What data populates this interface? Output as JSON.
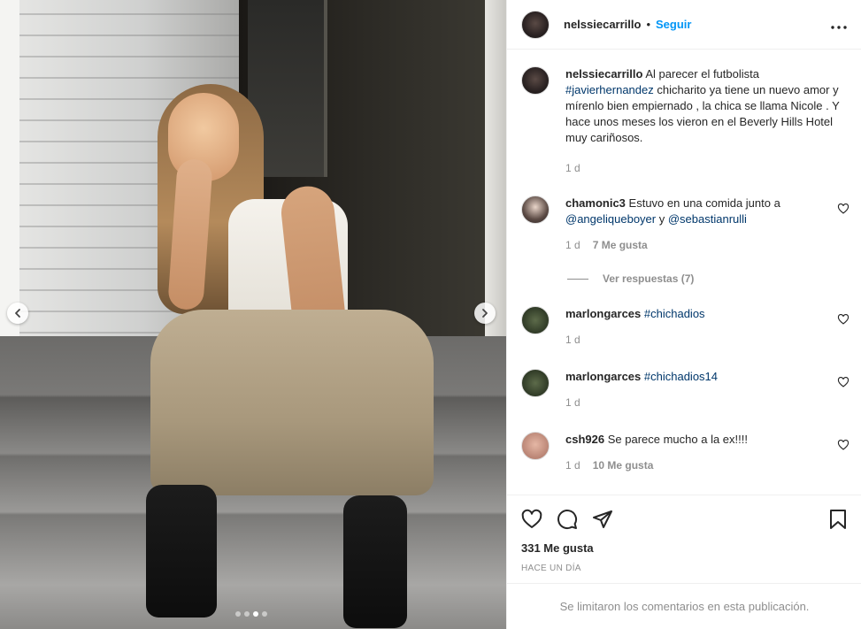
{
  "post": {
    "username": "nelssiecarrillo",
    "separator": "•",
    "follow_label": "Seguir",
    "more_icon": "more-horizontal-icon",
    "carousel": {
      "prev_icon": "chevron-left-icon",
      "next_icon": "chevron-right-icon",
      "slide_count": 4,
      "active_index": 2
    }
  },
  "caption": {
    "username": "nelssiecarrillo",
    "text_before": "Al parecer el futbolista",
    "hashtag": "#javierhernandez",
    "text_after": "chicharito ya tiene un nuevo amor y mírenlo bien empiernado , la chica se llama Nicole . Y hace unos meses los vieron en el Beverly Hills Hotel muy cariñosos.",
    "time": "1 d"
  },
  "comments": [
    {
      "username": "chamonic3",
      "text_before": "Estuvo en una comida junto a",
      "mention1": "@angeliqueboyer",
      "joiner": "y",
      "mention2": "@sebastianrulli",
      "time": "1 d",
      "likes": "7 Me gusta",
      "replies_label": "Ver respuestas (7)"
    },
    {
      "username": "marlongarces",
      "hashtag": "#chichadios",
      "time": "1 d"
    },
    {
      "username": "marlongarces",
      "hashtag": "#chichadios14",
      "time": "1 d"
    },
    {
      "username": "csh926",
      "text": "Se parece mucho a la ex!!!!",
      "time": "1 d",
      "likes": "10 Me gusta"
    }
  ],
  "actions": {
    "like_count": "331 Me gusta",
    "time_ago": "HACE UN DÍA",
    "limited_notice": "Se limitaron los comentarios en esta publicación."
  },
  "colors": {
    "accent": "#0095f6",
    "link": "#00376b",
    "muted": "#8e8e8e",
    "text": "#262626"
  }
}
